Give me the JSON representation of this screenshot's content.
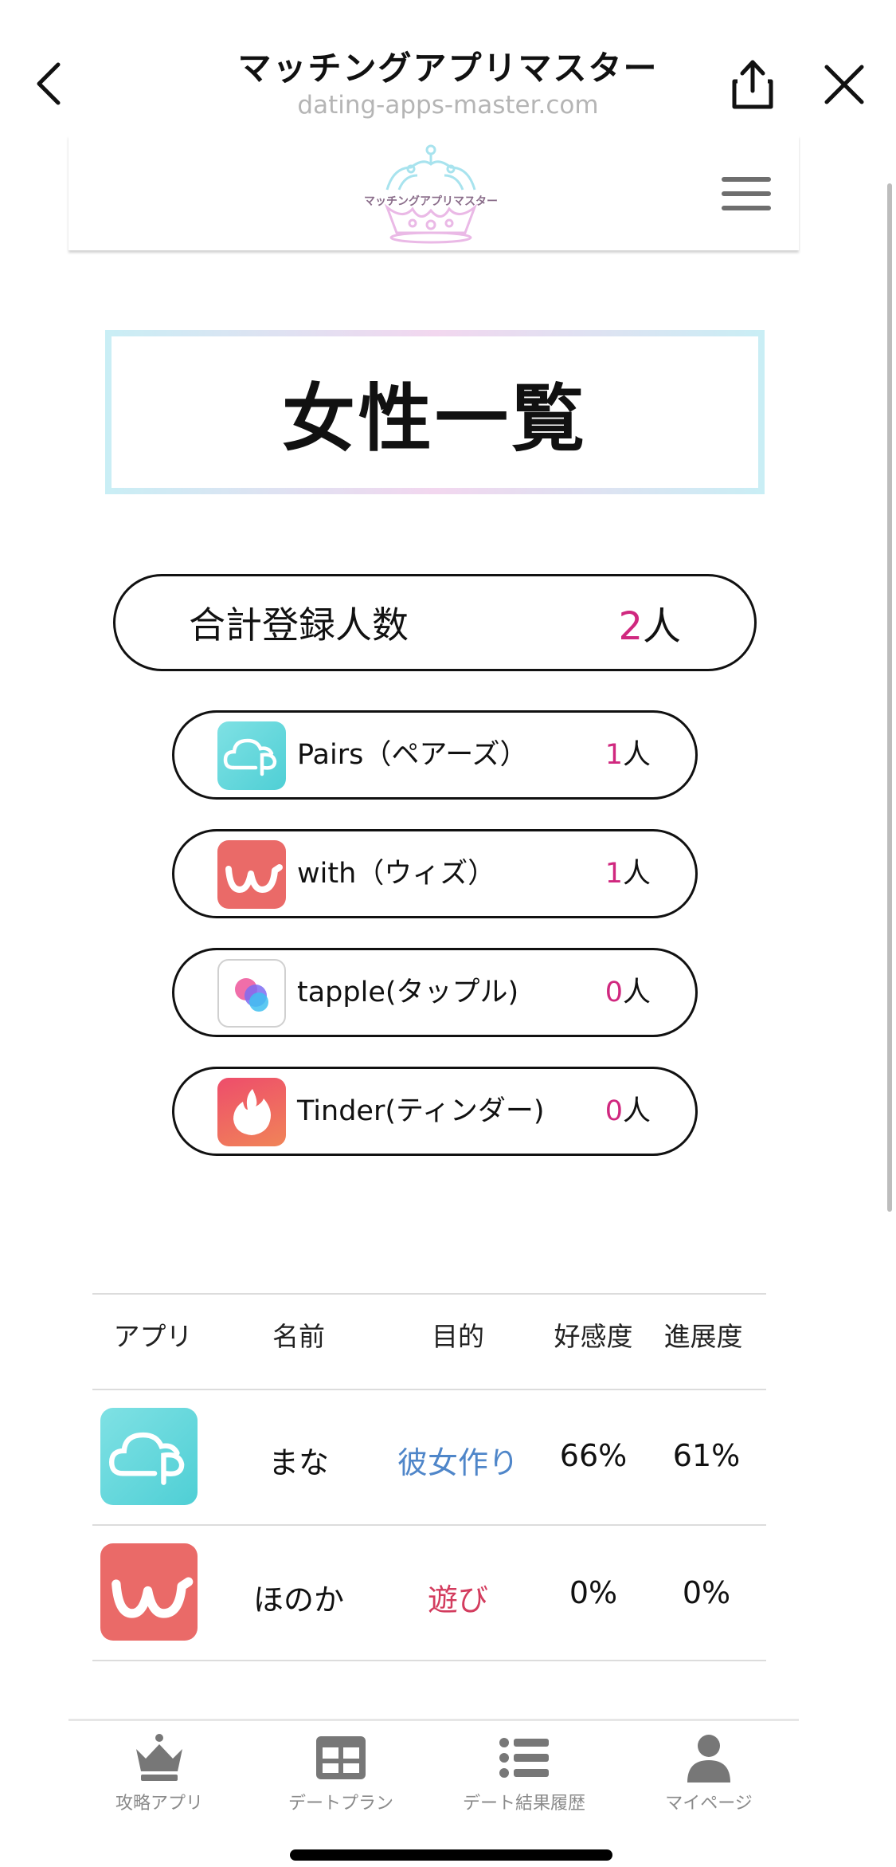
{
  "browser": {
    "title": "マッチングアプリマスター",
    "url": "dating-apps-master.com"
  },
  "site": {
    "logo_text": "マッチングアプリマスター"
  },
  "page": {
    "heading": "女性一覧"
  },
  "summary": {
    "total_label": "合計登録人数",
    "total_count": "2",
    "unit": "人",
    "apps": [
      {
        "icon": "pairs-app-icon",
        "name": "Pairs（ペアーズ）",
        "count": "1",
        "unit": "人"
      },
      {
        "icon": "with-app-icon",
        "name": "with（ウィズ）",
        "count": "1",
        "unit": "人"
      },
      {
        "icon": "tapple-app-icon",
        "name": "tapple(タップル)",
        "count": "0",
        "unit": "人"
      },
      {
        "icon": "tinder-app-icon",
        "name": "Tinder(ティンダー)",
        "count": "0",
        "unit": "人"
      }
    ]
  },
  "table": {
    "headers": [
      "アプリ",
      "名前",
      "目的",
      "好感度",
      "進展度"
    ],
    "rows": [
      {
        "app_icon": "pairs-app-icon",
        "name": "まな",
        "purpose": "彼女作り",
        "purpose_color": "#4f86c9",
        "favorability": "66%",
        "progress": "61%"
      },
      {
        "app_icon": "with-app-icon",
        "name": "ほのか",
        "purpose": "遊び",
        "purpose_color": "#d33c5e",
        "favorability": "0%",
        "progress": "0%"
      }
    ]
  },
  "tabbar": {
    "items": [
      {
        "icon": "crown-icon",
        "label": "攻略アプリ"
      },
      {
        "icon": "grid-icon",
        "label": "デートプラン"
      },
      {
        "icon": "list-icon",
        "label": "デート結果履歴"
      },
      {
        "icon": "person-icon",
        "label": "マイページ"
      }
    ]
  },
  "colors": {
    "accent_pink": "#d0287f",
    "purpose_blue": "#4f86c9",
    "purpose_red": "#d33c5e"
  }
}
